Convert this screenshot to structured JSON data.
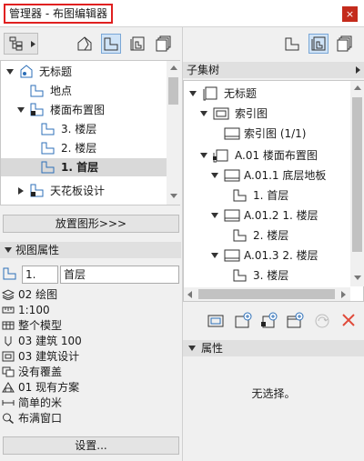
{
  "window": {
    "title": "管理器 - 布图编辑器",
    "close_glyph": "×"
  },
  "left_tree": {
    "items": [
      {
        "label": "无标题",
        "icon": "project-icon"
      },
      {
        "label": "地点",
        "icon": "plan-view-icon"
      },
      {
        "label": "楼面布置图",
        "icon": "story-folder-icon"
      },
      {
        "label": "3. 楼层",
        "icon": "plan-view-icon"
      },
      {
        "label": "2. 楼层",
        "icon": "plan-view-icon"
      },
      {
        "label": "1. 首层",
        "icon": "plan-view-icon",
        "selected": true
      },
      {
        "label": "天花板设计",
        "icon": "ceiling-folder-icon"
      }
    ]
  },
  "place_button": "放置图形>>>",
  "view_props": {
    "header": "视图属性",
    "id_value": "1.",
    "name_value": "首层",
    "rows": [
      {
        "icon": "layer-combination-icon",
        "text": "02 绘图"
      },
      {
        "icon": "scale-icon",
        "text": "1:100"
      },
      {
        "icon": "structure-display-icon",
        "text": "整个模型"
      },
      {
        "icon": "pen-set-icon",
        "text": "03 建筑 100"
      },
      {
        "icon": "model-view-option-icon",
        "text": "03 建筑设计"
      },
      {
        "icon": "override-icon",
        "text": "没有覆盖"
      },
      {
        "icon": "renovation-filter-icon",
        "text": "01 现有方案"
      },
      {
        "icon": "dimension-icon",
        "text": "简单的米"
      },
      {
        "icon": "zoom-icon",
        "text": "布满窗口"
      }
    ],
    "settings_button": "设置..."
  },
  "right_panel": {
    "subset_header": "子集树",
    "tree": [
      {
        "label": "无标题",
        "icon": "layout-book-icon"
      },
      {
        "label": "索引图",
        "icon": "master-layout-icon"
      },
      {
        "label": "索引图 (1/1)",
        "icon": "layout-sheet-icon"
      },
      {
        "label": "A.01 楼面布置图",
        "icon": "subset-icon"
      },
      {
        "label": "A.01.1 底层地板",
        "icon": "layout-sheet-icon"
      },
      {
        "label": "1. 首层",
        "icon": "plan-view-icon"
      },
      {
        "label": "A.01.2 1. 楼层",
        "icon": "layout-sheet-icon"
      },
      {
        "label": "2. 楼层",
        "icon": "plan-view-icon"
      },
      {
        "label": "A.01.3 2. 楼层",
        "icon": "layout-sheet-icon"
      },
      {
        "label": "3. 楼层",
        "icon": "plan-view-icon"
      }
    ],
    "props_header": "属性",
    "no_selection": "无选择。"
  },
  "colors": {
    "accent": "#2d6fb8",
    "delete": "#e04a3a",
    "title_highlight": "#e02020"
  }
}
